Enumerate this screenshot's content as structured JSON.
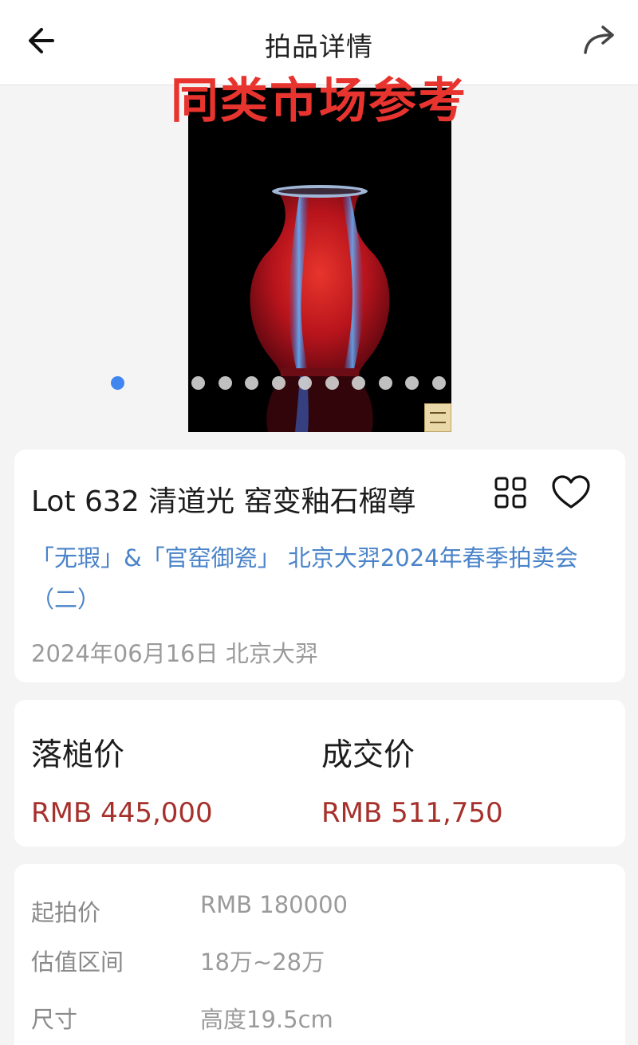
{
  "nav": {
    "title": "拍品详情",
    "back_icon": "arrow-left-icon",
    "share_icon": "share-arrow-icon"
  },
  "overlay_label": "同类市场参考",
  "gallery": {
    "image_count": 11,
    "active_index": 0,
    "active_dot_color": "#3f86f0",
    "inactive_dot_color": "#d0d0d0"
  },
  "lot": {
    "title": "Lot 632 清道光 窑变釉石榴尊",
    "sale_name": "「无瑕」&「官窑御瓷」 北京大羿2024年春季拍卖会（二）",
    "date_house": "2024年06月16日 北京大羿",
    "grid_icon": "grid-four-icon",
    "favorite_icon": "heart-outline-icon"
  },
  "prices": {
    "hammer_label": "落槌价",
    "hammer_value": "RMB 445,000",
    "deal_label": "成交价",
    "deal_value": "RMB 511,750",
    "value_color": "#a6302b"
  },
  "details": [
    {
      "label": "起拍价",
      "value": "RMB 180000"
    },
    {
      "label": "估值区间",
      "value": "18万~28万"
    },
    {
      "label": "尺寸",
      "value": "高度19.5cm"
    }
  ],
  "colors": {
    "link": "#4a83c9",
    "overlay_red": "#e8342f"
  }
}
